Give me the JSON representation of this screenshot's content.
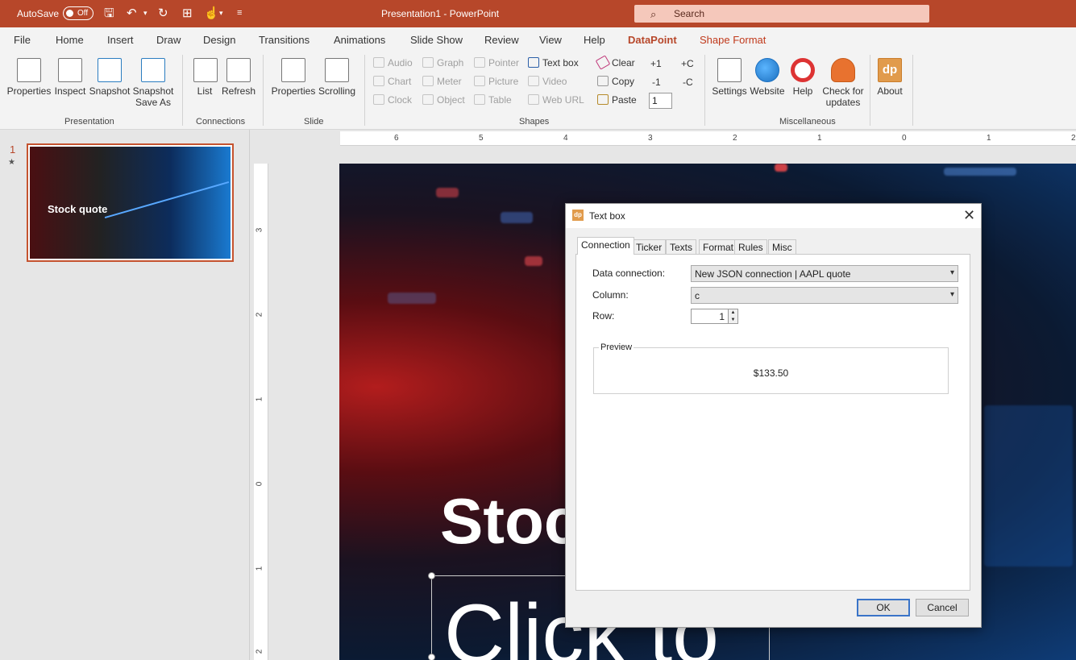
{
  "titlebar": {
    "autosave_label": "AutoSave",
    "autosave_state": "Off",
    "doc_title": "Presentation1  -  PowerPoint",
    "search_placeholder": "Search"
  },
  "tabs": [
    "File",
    "Home",
    "Insert",
    "Draw",
    "Design",
    "Transitions",
    "Animations",
    "Slide Show",
    "Review",
    "View",
    "Help",
    "DataPoint",
    "Shape Format"
  ],
  "active_tab": "DataPoint",
  "ribbon": {
    "presentation": {
      "group": "Presentation",
      "buttons": [
        "Properties",
        "Inspect",
        "Snapshot",
        "Snapshot",
        "Save As"
      ]
    },
    "connections": {
      "group": "Connections",
      "buttons": [
        "List",
        "Refresh"
      ]
    },
    "slide": {
      "group": "Slide",
      "buttons": [
        "Properties",
        "Scrolling"
      ]
    },
    "shapes": {
      "group": "Shapes",
      "col1": [
        "Audio",
        "Chart",
        "Clock"
      ],
      "col2": [
        "Graph",
        "Meter",
        "Object"
      ],
      "col3": [
        "Pointer",
        "Picture",
        "Table"
      ],
      "col4": [
        "Text box",
        "Video",
        "Web URL"
      ],
      "col5": [
        "Clear",
        "Copy",
        "Paste"
      ],
      "col6": [
        "+1",
        "-1"
      ],
      "col7": [
        "+C",
        "-C"
      ],
      "spin_value": "1"
    },
    "misc": {
      "group": "Miscellaneous",
      "buttons": [
        "Settings",
        "Website",
        "Help",
        "Check for",
        "updates",
        "About"
      ]
    }
  },
  "slide_panel": {
    "number": "1",
    "star": "★",
    "thumb_title": "Stock quote"
  },
  "ruler": {
    "horizontal": [
      "6",
      "5",
      "4",
      "3",
      "2",
      "1",
      "0",
      "1",
      "2"
    ],
    "vertical": [
      "3",
      "2",
      "1",
      "0",
      "1",
      "2"
    ]
  },
  "slide": {
    "title_visible": "Stoc",
    "subtitle_visible": "Click to"
  },
  "dialog": {
    "title": "Text box",
    "icon_text": "dp",
    "tabs": [
      "Connection",
      "Ticker",
      "Texts",
      "Format",
      "Rules",
      "Misc"
    ],
    "active_tab": "Connection",
    "data_connection_label": "Data connection:",
    "data_connection_value": "New JSON connection | AAPL quote",
    "column_label": "Column:",
    "column_value": "c",
    "row_label": "Row:",
    "row_value": "1",
    "preview_label": "Preview",
    "preview_value": "$133.50",
    "ok_label": "OK",
    "cancel_label": "Cancel"
  },
  "colors": {
    "accent": "#b7472a",
    "ribbon_bg": "#f3f3f3",
    "dialog_bg": "#f0f0f0"
  }
}
